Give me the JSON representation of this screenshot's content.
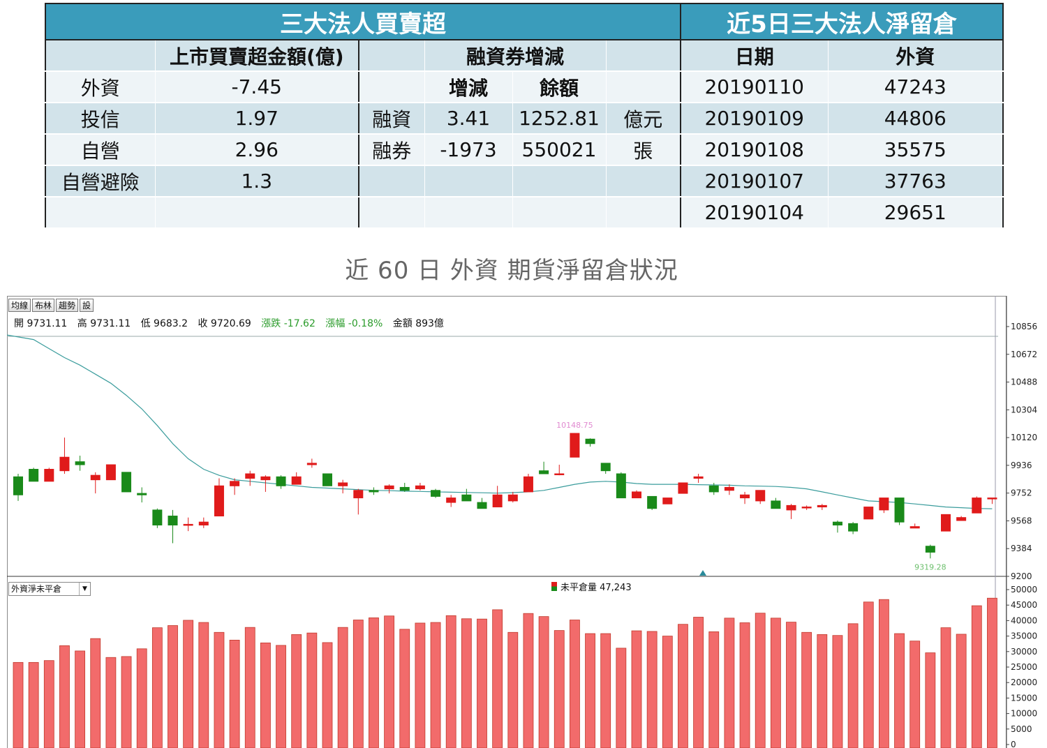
{
  "table": {
    "left_title": "三大法人買賣超",
    "right_title": "近5日三大法人淨留倉",
    "col_amount": "上市買賣超金額(億)",
    "col_margin": "融資券增減",
    "col_date": "日期",
    "col_foreign": "外資",
    "sub_change": "增減",
    "sub_balance": "餘額",
    "rows": [
      {
        "name": "外資",
        "amount": "-7.45",
        "m_label": "",
        "m_change": "",
        "m_balance": "",
        "m_unit": "",
        "date": "20190110",
        "net": "47243"
      },
      {
        "name": "投信",
        "amount": "1.97",
        "m_label": "融資",
        "m_change": "3.41",
        "m_balance": "1252.81",
        "m_unit": "億元",
        "date": "20190109",
        "net": "44806"
      },
      {
        "name": "自營",
        "amount": "2.96",
        "m_label": "融券",
        "m_change": "-1973",
        "m_balance": "550021",
        "m_unit": "張",
        "date": "20190108",
        "net": "35575"
      },
      {
        "name": "自營避險",
        "amount": "1.3",
        "m_label": "",
        "m_change": "",
        "m_balance": "",
        "m_unit": "",
        "date": "20190107",
        "net": "37763"
      },
      {
        "name": "",
        "amount": "",
        "m_label": "",
        "m_change": "",
        "m_balance": "",
        "m_unit": "",
        "date": "20190104",
        "net": "29651"
      }
    ]
  },
  "chart_title": "近 60 日 外資 期貨淨留倉狀況",
  "toolbar": {
    "buttons": [
      "均線",
      "布林",
      "趨勢",
      "設"
    ]
  },
  "quote": {
    "open": "開 9731.11",
    "high": "高 9731.11",
    "low": "低 9683.2",
    "close": "收 9720.69",
    "change": "漲跌 -17.62",
    "pct": "漲幅 -0.18%",
    "amount": "金額 893億"
  },
  "volume_panel": {
    "select_value": "外資淨未平倉",
    "legend": "未平倉量 47,243"
  },
  "colors": {
    "up": "#e01b1b",
    "down": "#1a8a1a",
    "ma": "#3a9c9c",
    "bar": "#f26b6b"
  },
  "chart_data": [
    {
      "type": "candlestick",
      "y_ticks": [
        10856,
        10672,
        10488,
        10304,
        10120,
        9936,
        9752,
        9568,
        9384,
        9200
      ],
      "ylim": [
        9200,
        10856
      ],
      "annotations": [
        "10148.75",
        "9319.28"
      ],
      "ohlc": [
        [
          9860,
          9880,
          9700,
          9740
        ],
        [
          9910,
          9920,
          9830,
          9830
        ],
        [
          9830,
          9920,
          9830,
          9910
        ],
        [
          9900,
          10120,
          9880,
          9990
        ],
        [
          9960,
          10000,
          9900,
          9940
        ],
        [
          9840,
          9890,
          9750,
          9870
        ],
        [
          9840,
          9920,
          9840,
          9940
        ],
        [
          9890,
          9890,
          9760,
          9760
        ],
        [
          9750,
          9790,
          9690,
          9740
        ],
        [
          9640,
          9650,
          9520,
          9540
        ],
        [
          9600,
          9640,
          9420,
          9540
        ],
        [
          9540,
          9590,
          9500,
          9545
        ],
        [
          9540,
          9590,
          9520,
          9560
        ],
        [
          9600,
          9850,
          9600,
          9800
        ],
        [
          9800,
          9850,
          9740,
          9830
        ],
        [
          9850,
          9900,
          9800,
          9880
        ],
        [
          9840,
          9870,
          9760,
          9860
        ],
        [
          9860,
          9870,
          9780,
          9800
        ],
        [
          9810,
          9890,
          9810,
          9860
        ],
        [
          9940,
          9980,
          9920,
          9950
        ],
        [
          9880,
          9880,
          9800,
          9800
        ],
        [
          9800,
          9840,
          9750,
          9820
        ],
        [
          9720,
          9780,
          9610,
          9770
        ],
        [
          9770,
          9790,
          9740,
          9760
        ],
        [
          9780,
          9810,
          9750,
          9800
        ],
        [
          9790,
          9820,
          9760,
          9770
        ],
        [
          9780,
          9820,
          9770,
          9800
        ],
        [
          9770,
          9780,
          9720,
          9730
        ],
        [
          9690,
          9740,
          9660,
          9720
        ],
        [
          9740,
          9780,
          9700,
          9700
        ],
        [
          9690,
          9720,
          9650,
          9650
        ],
        [
          9660,
          9800,
          9660,
          9740
        ],
        [
          9700,
          9760,
          9690,
          9740
        ],
        [
          9760,
          9880,
          9760,
          9860
        ],
        [
          9900,
          9960,
          9880,
          9880
        ],
        [
          9880,
          9940,
          9870,
          9880
        ],
        [
          9990,
          10149,
          9990,
          10148
        ],
        [
          10110,
          10115,
          10060,
          10080
        ],
        [
          9950,
          9950,
          9880,
          9900
        ],
        [
          9880,
          9890,
          9720,
          9720
        ],
        [
          9720,
          9770,
          9730,
          9760
        ],
        [
          9730,
          9730,
          9640,
          9650
        ],
        [
          9680,
          9720,
          9680,
          9720
        ],
        [
          9750,
          9810,
          9750,
          9820
        ],
        [
          9850,
          9880,
          9820,
          9860
        ],
        [
          9800,
          9820,
          9740,
          9760
        ],
        [
          9770,
          9810,
          9740,
          9790
        ],
        [
          9720,
          9760,
          9680,
          9740
        ],
        [
          9700,
          9760,
          9680,
          9770
        ],
        [
          9700,
          9720,
          9650,
          9650
        ],
        [
          9640,
          9680,
          9580,
          9670
        ],
        [
          9660,
          9670,
          9640,
          9660
        ],
        [
          9660,
          9680,
          9640,
          9670
        ],
        [
          9560,
          9570,
          9490,
          9540
        ],
        [
          9550,
          9560,
          9480,
          9500
        ],
        [
          9580,
          9660,
          9580,
          9660
        ],
        [
          9640,
          9720,
          9620,
          9720
        ],
        [
          9720,
          9720,
          9540,
          9560
        ],
        [
          9520,
          9550,
          9520,
          9530
        ],
        [
          9400,
          9410,
          9319,
          9360
        ],
        [
          9500,
          9610,
          9500,
          9610
        ],
        [
          9570,
          9600,
          9570,
          9590
        ],
        [
          9620,
          9730,
          9620,
          9720
        ],
        [
          9720,
          9720,
          9680,
          9720
        ]
      ],
      "ma": [
        10800,
        10770,
        10710,
        10650,
        10600,
        10540,
        10480,
        10400,
        10310,
        10200,
        10080,
        9980,
        9910,
        9870,
        9840,
        9830,
        9820,
        9810,
        9800,
        9790,
        9785,
        9780,
        9775,
        9770,
        9768,
        9765,
        9763,
        9760,
        9758,
        9756,
        9754,
        9752,
        9755,
        9760,
        9770,
        9790,
        9810,
        9825,
        9830,
        9825,
        9815,
        9810,
        9810,
        9810,
        9808,
        9806,
        9804,
        9800,
        9798,
        9796,
        9790,
        9780,
        9760,
        9740,
        9720,
        9700,
        9695,
        9690,
        9680,
        9670,
        9660,
        9655,
        9650,
        9648
      ]
    },
    {
      "type": "bar",
      "series_name": "外資淨未平倉",
      "y_ticks": [
        50000,
        45000,
        40000,
        35000,
        30000,
        25000,
        20000,
        15000,
        10000,
        5000,
        0
      ],
      "ylim": [
        0,
        50000
      ],
      "values": [
        26500,
        26500,
        27100,
        31900,
        30200,
        34200,
        28100,
        28400,
        30900,
        37700,
        38400,
        40100,
        39400,
        36200,
        33700,
        37800,
        32800,
        32000,
        35500,
        36000,
        32900,
        37800,
        40200,
        40900,
        41500,
        37200,
        39200,
        39400,
        41600,
        40600,
        40500,
        43500,
        36200,
        42300,
        41300,
        36800,
        40200,
        35800,
        35800,
        31100,
        36700,
        36500,
        35000,
        38800,
        41100,
        36400,
        40800,
        39300,
        42400,
        40800,
        39500,
        36200,
        35500,
        35200,
        39000,
        46000,
        46800,
        35800,
        33400,
        29600,
        37700,
        35600,
        44800,
        47243
      ]
    }
  ]
}
